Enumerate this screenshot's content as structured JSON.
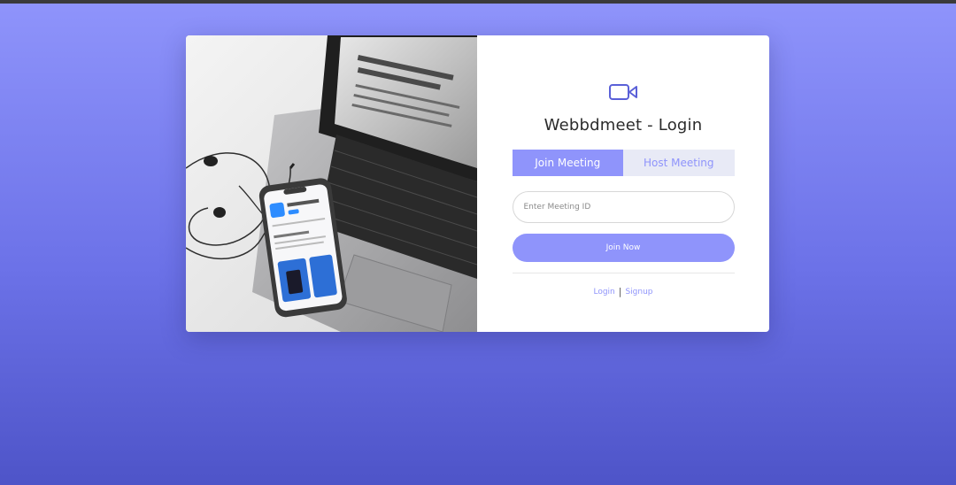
{
  "app": {
    "title": "Webbdmeet - Login"
  },
  "icons": {
    "logo": "video-camera-icon"
  },
  "colors": {
    "accent": "#8f94fb",
    "tab_inactive_bg": "#e8eaf6"
  },
  "tabs": [
    {
      "label": "Join Meeting",
      "active": true
    },
    {
      "label": "Host Meeting",
      "active": false
    }
  ],
  "meeting_input": {
    "placeholder": "Enter Meeting ID",
    "value": ""
  },
  "join_button": {
    "label": "Join Now"
  },
  "links": {
    "login": "Login",
    "separator": "|",
    "signup": "Signup"
  }
}
